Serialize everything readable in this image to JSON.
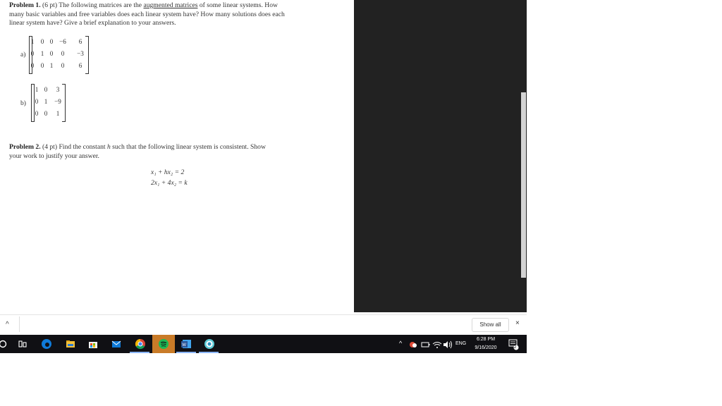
{
  "problem1": {
    "heading": "Problem 1.",
    "points": "(6 pt)",
    "text_a": "The following matrices are the",
    "text_link": "augmented matrices",
    "text_b": "of some linear systems. How",
    "line2": "many basic variables and free variables does each linear system have? How many solutions does each",
    "line3": "linear system have? Give a brief explanation to your answers."
  },
  "matrix_a": {
    "label": "a)",
    "rows": [
      [
        "1",
        "0",
        "0",
        "−6",
        "6"
      ],
      [
        "0",
        "1",
        "0",
        "0",
        "−3"
      ],
      [
        "0",
        "0",
        "1",
        "0",
        "6"
      ]
    ]
  },
  "matrix_b": {
    "label": "b)",
    "rows": [
      [
        "1",
        "0",
        "3"
      ],
      [
        "0",
        "1",
        "−9"
      ],
      [
        "0",
        "0",
        "1"
      ]
    ]
  },
  "problem2": {
    "heading": "Problem 2.",
    "points": "(4 pt)",
    "text_a": "Find the constant",
    "var_h": "h",
    "text_b": "such that the following linear system is consistent. Show",
    "line2": "your work to justify your answer.",
    "eq1": "x₁ + hx₂ = 2",
    "eq2": "2x₁ + 4x₂ = k"
  },
  "download_bar": {
    "show_all": "Show all",
    "close": "×",
    "expand": "^"
  },
  "taskbar": {
    "icons": [
      "search-icon",
      "task-view-icon",
      "edge-icon",
      "file-explorer-icon",
      "store-icon",
      "mail-icon",
      "chrome-icon",
      "spotify-icon",
      "word-icon",
      "app-icon"
    ],
    "tray_language": "ENG",
    "time": "6:28 PM",
    "date": "9/16/2020",
    "notification_count": "2"
  },
  "colors": {
    "taskbar": "#101014",
    "panel": "#222222",
    "chrome_active": "#f39c12",
    "spotify": "#1db954",
    "word": "#2b579a",
    "edge": "#0f7ad8"
  }
}
